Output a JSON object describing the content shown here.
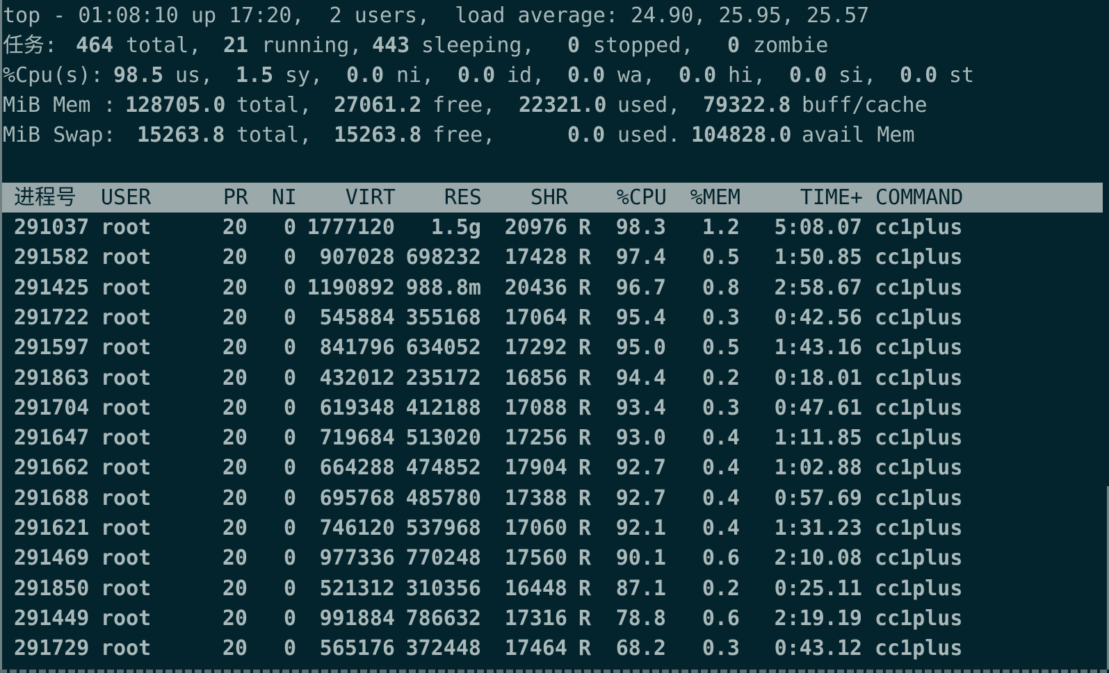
{
  "summary": {
    "line1": "top - 01:08:10 up 17:20,  2 users,  load average: 24.90, 25.95, 25.57",
    "tasks": {
      "label": "任务:",
      "total": "464",
      "total_label": "total,",
      "running": "21",
      "running_label": "running,",
      "sleeping": "443",
      "sleeping_label": "sleeping,",
      "stopped": "0",
      "stopped_label": "stopped,",
      "zombie": "0",
      "zombie_label": "zombie"
    },
    "cpu": {
      "label": "%Cpu(s):",
      "us": "98.5",
      "us_label": "us,",
      "sy": "1.5",
      "sy_label": "sy,",
      "ni": "0.0",
      "ni_label": "ni,",
      "id": "0.0",
      "id_label": "id,",
      "wa": "0.0",
      "wa_label": "wa,",
      "hi": "0.0",
      "hi_label": "hi,",
      "si": "0.0",
      "si_label": "si,",
      "st": "0.0",
      "st_label": "st"
    },
    "mem": {
      "label": "MiB Mem :",
      "total": "128705.0",
      "total_label": "total,",
      "free": "27061.2",
      "free_label": "free,",
      "used": "22321.0",
      "used_label": "used,",
      "buff": "79322.8",
      "buff_label": "buff/cache"
    },
    "swap": {
      "label": "MiB Swap:",
      "total": "15263.8",
      "total_label": "total,",
      "free": "15263.8",
      "free_label": "free,",
      "used": "0.0",
      "used_label": "used.",
      "avail": "104828.0",
      "avail_label": "avail Mem"
    }
  },
  "columns": {
    "pid": "进程号",
    "user": "USER",
    "pr": "PR",
    "ni": "NI",
    "virt": "VIRT",
    "res": "RES",
    "shr": "SHR",
    "cpu": "%CPU",
    "mem": "%MEM",
    "time": "TIME+",
    "command": "COMMAND"
  },
  "processes": [
    {
      "pid": "291037",
      "user": "root",
      "pr": "20",
      "ni": "0",
      "virt": "1777120",
      "res": "1.5g",
      "shr": "20976",
      "s": "R",
      "cpu": "98.3",
      "mem": "1.2",
      "time": "5:08.07",
      "command": "cc1plus"
    },
    {
      "pid": "291582",
      "user": "root",
      "pr": "20",
      "ni": "0",
      "virt": "907028",
      "res": "698232",
      "shr": "17428",
      "s": "R",
      "cpu": "97.4",
      "mem": "0.5",
      "time": "1:50.85",
      "command": "cc1plus"
    },
    {
      "pid": "291425",
      "user": "root",
      "pr": "20",
      "ni": "0",
      "virt": "1190892",
      "res": "988.8m",
      "shr": "20436",
      "s": "R",
      "cpu": "96.7",
      "mem": "0.8",
      "time": "2:58.67",
      "command": "cc1plus"
    },
    {
      "pid": "291722",
      "user": "root",
      "pr": "20",
      "ni": "0",
      "virt": "545884",
      "res": "355168",
      "shr": "17064",
      "s": "R",
      "cpu": "95.4",
      "mem": "0.3",
      "time": "0:42.56",
      "command": "cc1plus"
    },
    {
      "pid": "291597",
      "user": "root",
      "pr": "20",
      "ni": "0",
      "virt": "841796",
      "res": "634052",
      "shr": "17292",
      "s": "R",
      "cpu": "95.0",
      "mem": "0.5",
      "time": "1:43.16",
      "command": "cc1plus"
    },
    {
      "pid": "291863",
      "user": "root",
      "pr": "20",
      "ni": "0",
      "virt": "432012",
      "res": "235172",
      "shr": "16856",
      "s": "R",
      "cpu": "94.4",
      "mem": "0.2",
      "time": "0:18.01",
      "command": "cc1plus"
    },
    {
      "pid": "291704",
      "user": "root",
      "pr": "20",
      "ni": "0",
      "virt": "619348",
      "res": "412188",
      "shr": "17088",
      "s": "R",
      "cpu": "93.4",
      "mem": "0.3",
      "time": "0:47.61",
      "command": "cc1plus"
    },
    {
      "pid": "291647",
      "user": "root",
      "pr": "20",
      "ni": "0",
      "virt": "719684",
      "res": "513020",
      "shr": "17256",
      "s": "R",
      "cpu": "93.0",
      "mem": "0.4",
      "time": "1:11.85",
      "command": "cc1plus"
    },
    {
      "pid": "291662",
      "user": "root",
      "pr": "20",
      "ni": "0",
      "virt": "664288",
      "res": "474852",
      "shr": "17904",
      "s": "R",
      "cpu": "92.7",
      "mem": "0.4",
      "time": "1:02.88",
      "command": "cc1plus"
    },
    {
      "pid": "291688",
      "user": "root",
      "pr": "20",
      "ni": "0",
      "virt": "695768",
      "res": "485780",
      "shr": "17388",
      "s": "R",
      "cpu": "92.7",
      "mem": "0.4",
      "time": "0:57.69",
      "command": "cc1plus"
    },
    {
      "pid": "291621",
      "user": "root",
      "pr": "20",
      "ni": "0",
      "virt": "746120",
      "res": "537968",
      "shr": "17060",
      "s": "R",
      "cpu": "92.1",
      "mem": "0.4",
      "time": "1:31.23",
      "command": "cc1plus"
    },
    {
      "pid": "291469",
      "user": "root",
      "pr": "20",
      "ni": "0",
      "virt": "977336",
      "res": "770248",
      "shr": "17560",
      "s": "R",
      "cpu": "90.1",
      "mem": "0.6",
      "time": "2:10.08",
      "command": "cc1plus"
    },
    {
      "pid": "291850",
      "user": "root",
      "pr": "20",
      "ni": "0",
      "virt": "521312",
      "res": "310356",
      "shr": "16448",
      "s": "R",
      "cpu": "87.1",
      "mem": "0.2",
      "time": "0:25.11",
      "command": "cc1plus"
    },
    {
      "pid": "291449",
      "user": "root",
      "pr": "20",
      "ni": "0",
      "virt": "991884",
      "res": "786632",
      "shr": "17316",
      "s": "R",
      "cpu": "78.8",
      "mem": "0.6",
      "time": "2:19.19",
      "command": "cc1plus"
    },
    {
      "pid": "291729",
      "user": "root",
      "pr": "20",
      "ni": "0",
      "virt": "565176",
      "res": "372448",
      "shr": "17464",
      "s": "R",
      "cpu": "68.2",
      "mem": "0.3",
      "time": "0:43.12",
      "command": "cc1plus"
    }
  ],
  "colors": {
    "background": "#04242d",
    "foreground": "#a9b9ba",
    "header_bar": "#9ba9aa"
  }
}
